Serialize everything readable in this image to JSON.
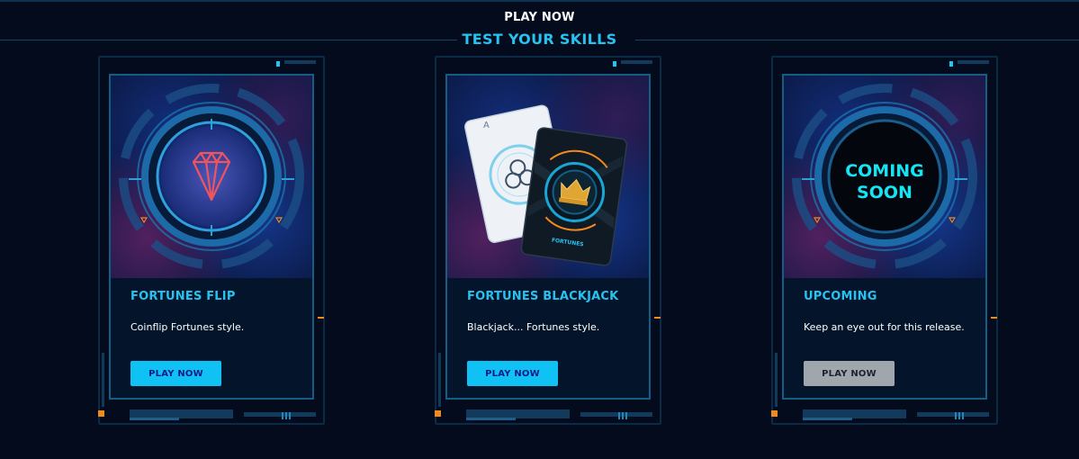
{
  "header": {
    "kicker": "PLAY NOW",
    "title": "TEST YOUR SKILLS"
  },
  "cards": [
    {
      "title": "FORTUNES FLIP",
      "description": "Coinflip Fortunes style.",
      "button_label": "PLAY NOW",
      "art_icon": "gem-icon",
      "button_enabled": true
    },
    {
      "title": "FORTUNES BLACKJACK",
      "description": "Blackjack... Fortunes style.",
      "button_label": "PLAY NOW",
      "art_icon": "playing-cards-icon",
      "card_rank": "A",
      "card_brand": "FORTUNES",
      "button_enabled": true
    },
    {
      "title": "UPCOMING",
      "description": "Keep an eye out for this release.",
      "button_label": "PLAY NOW",
      "art_line1": "COMING",
      "art_line2": "SOON",
      "button_enabled": false
    }
  ],
  "colors": {
    "background": "#030b1c",
    "accent": "#27c3f0",
    "button": "#10c2f4",
    "button_disabled": "#9fa7ad",
    "orange": "#f08a1c"
  }
}
